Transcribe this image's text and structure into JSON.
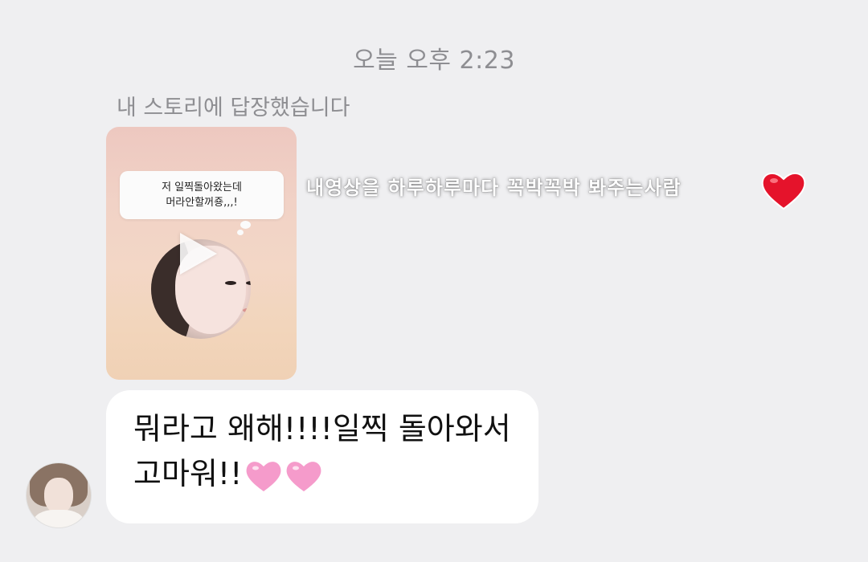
{
  "header": {
    "timestamp": "오늘 오후 2:23"
  },
  "story_reply": {
    "caption": "내 스토리에 답장했습니다",
    "bubble_line1": "저 일찍돌아왔는데",
    "bubble_line2": "머라안할꺼죵,,,!",
    "overlay_text": "내영상을 하루하루마다 꼭박꼭박 봐주는사람",
    "heart_icon": "red-heart-icon"
  },
  "message": {
    "text": "뭐라고 왜해!!!!일찍 돌아와서\n고마워!!",
    "emoji_icon": "pink-heart-icon",
    "emoji_count": 2
  },
  "colors": {
    "background": "#efeff1",
    "bubble": "#ffffff",
    "meta_text": "#8e8e92",
    "red_heart": "#e5132b",
    "pink_heart": "#f59bcb"
  }
}
